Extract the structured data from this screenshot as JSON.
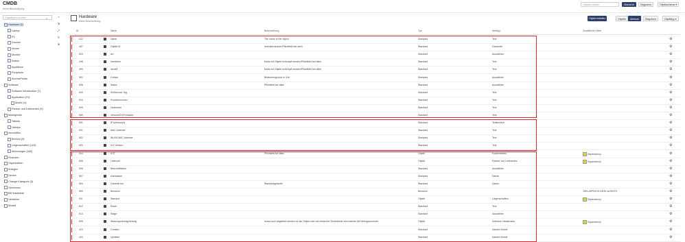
{
  "app": {
    "title": "CMDB",
    "subtitle": "Keine Beschreibung"
  },
  "topbar": {
    "search_placeholder": "Objekte suchen",
    "buttons": [
      {
        "label": "Übersicht",
        "active": true
      },
      {
        "label": "Diagramm",
        "active": false
      },
      {
        "label": "Objektschema ▾",
        "active": false
      }
    ]
  },
  "sidebar": {
    "search_placeholder": "Objekttypen suchen",
    "tree": [
      {
        "label": "Hardware (1)",
        "level": 0,
        "selected": true
      },
      {
        "label": "Laptop",
        "level": 1
      },
      {
        "label": "PC",
        "level": 1
      },
      {
        "label": "Drucker",
        "level": 1
      },
      {
        "label": "Server",
        "level": 1
      },
      {
        "label": "Monitor",
        "level": 1
      },
      {
        "label": "Switch",
        "level": 1
      },
      {
        "label": "Appliance",
        "level": 1
      },
      {
        "label": "Peripherie",
        "level": 1
      },
      {
        "label": "AccessPoints",
        "level": 1
      },
      {
        "label": "Software",
        "level": 0
      },
      {
        "label": "Software Infrastruktur (1)",
        "level": 1
      },
      {
        "label": "Application (21)",
        "level": 1
      },
      {
        "label": "Modul (4)",
        "level": 2
      },
      {
        "label": "Partner und Lieferanten (9)",
        "level": 1
      },
      {
        "label": "Mobilgeräte",
        "level": 0
      },
      {
        "label": "Tablets",
        "level": 1
      },
      {
        "label": "Handys",
        "level": 1
      },
      {
        "label": "Immobilien",
        "level": 0
      },
      {
        "label": "Bereich (9)",
        "level": 1
      },
      {
        "label": "Liegenschaften (110)",
        "level": 1
      },
      {
        "label": "Wohnungen (440)",
        "level": 1
      },
      {
        "label": "Finanzen",
        "level": 0
      },
      {
        "label": "Organization",
        "level": 0
      },
      {
        "label": "Anlagen",
        "level": 0
      },
      {
        "label": "Device",
        "level": 0
      },
      {
        "label": "Change Kategorie (3)",
        "level": 0
      },
      {
        "label": "Gehwerwx",
        "level": 0
      },
      {
        "label": "BB Warteliste",
        "level": 0
      },
      {
        "label": "Hersteller",
        "level": 0
      },
      {
        "label": "Modell",
        "level": 0
      }
    ]
  },
  "header": {
    "title": "Hardware",
    "subtitle": "Keine Beschreibung",
    "create_label": "Objekt erstellen",
    "views": [
      {
        "label": "Objekte",
        "active": false
      },
      {
        "label": "Attribute",
        "active": true
      },
      {
        "label": "Diagramm",
        "active": false
      },
      {
        "label": "Objekttyp ▾",
        "active": false
      }
    ]
  },
  "table": {
    "columns": [
      "ID",
      "Name",
      "Beschreibung",
      "Typ",
      "Werttyp",
      "Zusätzlicher Wert"
    ],
    "rows": [
      {
        "id": "422",
        "name": "Name",
        "desc": "The name of the object",
        "type": "Standard",
        "value_type": "Text",
        "extra": ""
      },
      {
        "id": "497",
        "name": "Objekt ID",
        "desc": "Inventarnummer/Pflichtfeld bei allen",
        "type": "Standard",
        "value_type": "Ganzzahl",
        "extra": ""
      },
      {
        "id": "503",
        "name": "Art",
        "desc": "",
        "type": "Standard",
        "value_type": "Auswählen",
        "extra": ""
      },
      {
        "id": "498",
        "name": "Hersteller",
        "desc": "Muss mit Objekt verknüpft werden/Pflichtfeld bei allen",
        "type": "Standard",
        "value_type": "Text",
        "extra": ""
      },
      {
        "id": "499",
        "name": "Modell",
        "desc": "Muss mit Objekt verknüpft werden/Pflichtfeld bei allen",
        "type": "Standard",
        "value_type": "Text",
        "extra": ""
      },
      {
        "id": "592",
        "name": "Grösse",
        "desc": "Bildschirmgrösse in Zoll",
        "type": "Standard",
        "value_type": "Auswählen",
        "extra": ""
      },
      {
        "id": "508",
        "name": "Status",
        "desc": "Pflichtfeld bei allen",
        "type": "Standard",
        "value_type": "Auswählen",
        "extra": ""
      },
      {
        "id": "500",
        "name": "SN/Service Tag",
        "desc": "",
        "type": "Standard",
        "value_type": "Text",
        "extra": ""
      },
      {
        "id": "510",
        "name": "Produktnummer",
        "desc": "",
        "type": "Standard",
        "value_type": "Text",
        "extra": ""
      },
      {
        "id": "509",
        "name": "Hostname",
        "desc": "",
        "type": "Standard",
        "value_type": "Text",
        "extra": ""
      },
      {
        "id": "589",
        "name": "Version/OS/Firmware",
        "desc": "",
        "type": "Standard",
        "value_type": "Text",
        "extra": ""
      },
      {
        "id": "591",
        "name": "IP Adresse(n)",
        "desc": "",
        "type": "Standard",
        "value_type": "Textbereich",
        "extra": ""
      },
      {
        "id": "501",
        "name": "MAC Adresse",
        "desc": "",
        "type": "Standard",
        "value_type": "Text",
        "extra": ""
      },
      {
        "id": "502",
        "name": "WLAN MAC Adresse",
        "desc": "",
        "type": "Standard",
        "value_type": "Text",
        "extra": ""
      },
      {
        "id": "593",
        "name": "ILO Version",
        "desc": "",
        "type": "Standard",
        "value_type": "Text",
        "extra": ""
      },
      {
        "id": "504",
        "name": "KST",
        "desc": "Pflichtfeld bei allen",
        "type": "Objekt",
        "value_type": "Kostenstellen",
        "extra": "Dependency"
      },
      {
        "id": "505",
        "name": "Lieferant",
        "desc": "",
        "type": "Objekt",
        "value_type": "Partner und Lieferanten",
        "extra": "Dependency"
      },
      {
        "id": "506",
        "name": "Beschaffdatum",
        "desc": "",
        "type": "Standard",
        "value_type": "Auswählen",
        "extra": ""
      },
      {
        "id": "507",
        "name": "Kaufdatum",
        "desc": "",
        "type": "Standard",
        "value_type": "Datum",
        "extra": ""
      },
      {
        "id": "594",
        "name": "Garantie bis",
        "desc": "Standardgarantie",
        "type": "Standard",
        "value_type": "Datum",
        "extra": ""
      },
      {
        "id": "550",
        "name": "Benutzer",
        "desc": "",
        "type": "Benutzer",
        "value_type": "",
        "extra": "JIRA-SERVICE-DESK-AGENTS"
      },
      {
        "id": "511",
        "name": "Standort",
        "desc": "",
        "type": "Objekt",
        "value_type": "Liegenschaften",
        "extra": "Dependency"
      },
      {
        "id": "512",
        "name": "Raum",
        "desc": "",
        "type": "Standard",
        "value_type": "Text",
        "extra": ""
      },
      {
        "id": "513",
        "name": "Etage",
        "desc": "",
        "type": "Standard",
        "value_type": "Auswählen",
        "extra": ""
      },
      {
        "id": "595",
        "name": "Wartungsvertrag/Vertrag",
        "desc": "muss noch abgeklärt werden ob als Objekt oder als einfaches Textfeld/Intr vom/welche Art/Vertragsnummer",
        "type": "Objekt",
        "value_type": "Software Infrastruktur",
        "extra": "Dependency"
      },
      {
        "id": "423",
        "name": "Created",
        "desc": "",
        "type": "Standard",
        "value_type": "Datum/Uhrzeit",
        "extra": ""
      },
      {
        "id": "424",
        "name": "Updated",
        "desc": "",
        "type": "Standard",
        "value_type": "Datum/Uhrzeit",
        "extra": ""
      }
    ]
  }
}
